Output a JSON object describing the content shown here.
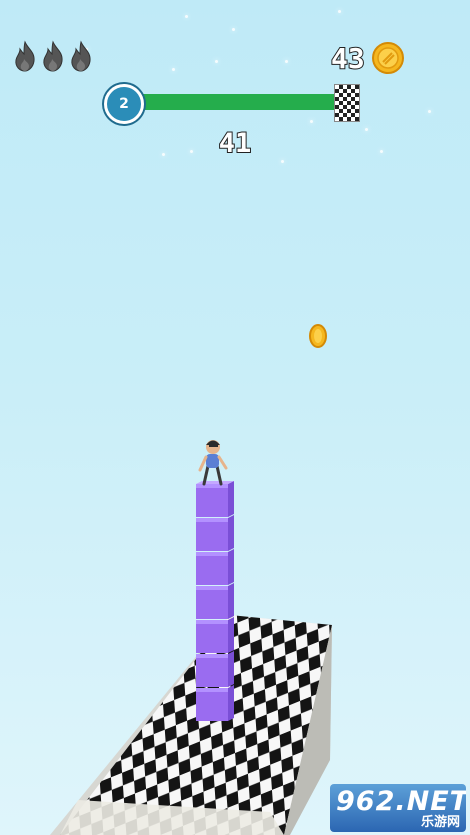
{
  "hud": {
    "lives_count": 3,
    "coins": "43",
    "level": "2",
    "progress": 1.0,
    "score": "41"
  },
  "icons": {
    "life": "flame-icon",
    "coin": "coin-icon",
    "finish": "checkered-flag-icon"
  },
  "scene": {
    "stacked_cubes": 7,
    "cube_color": "#9a6cf0",
    "track_pattern": "checkerboard"
  },
  "watermark": {
    "main": "962.NET",
    "sub": "乐游网"
  },
  "colors": {
    "sky": "#c9eef8",
    "progress_fill": "#25ad4c",
    "level_badge": "#2b8db8",
    "coin": "#f5b71f"
  }
}
